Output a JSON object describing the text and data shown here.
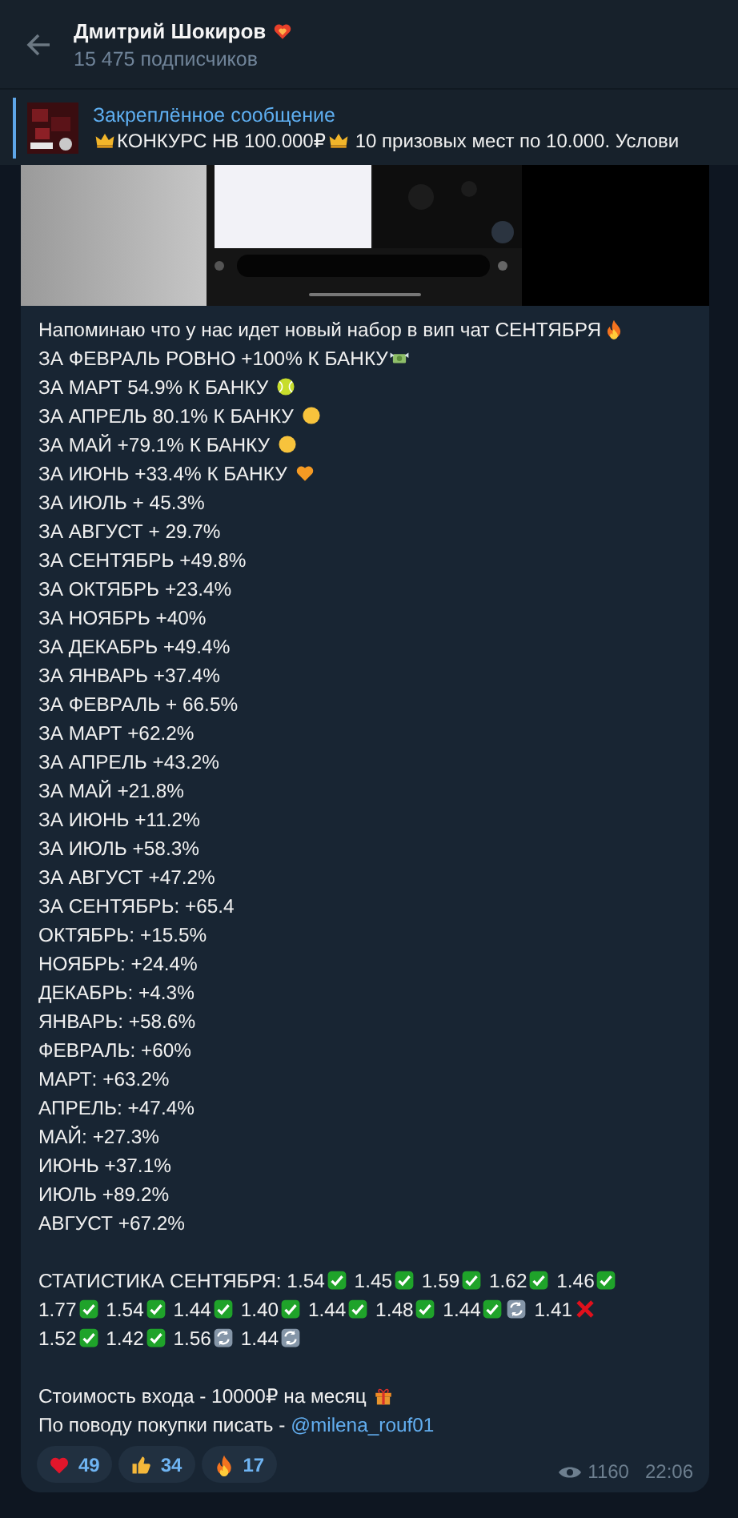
{
  "header": {
    "title": "Дмитрий Шокиров",
    "badge": {
      "kind": "heartfire"
    },
    "subtitle": "15 475 подписчиков"
  },
  "pinned": {
    "label": "Закреплённое сообщение",
    "parts": [
      {
        "kind": "crown"
      },
      {
        "kind": "text",
        "text": "КОНКУРС НВ 100.000₽"
      },
      {
        "kind": "crown"
      },
      {
        "kind": "text",
        "text": " 10 призовых мест по 10.000.  Услови"
      }
    ]
  },
  "message": {
    "lines": [
      {
        "kind": "text",
        "parts": [
          {
            "kind": "text",
            "text": "Напоминаю что у нас идет новый набор в вип чат СЕНТЯБРЯ"
          },
          {
            "kind": "fire"
          }
        ]
      },
      {
        "kind": "text",
        "parts": [
          {
            "kind": "text",
            "text": "ЗА ФЕВРАЛЬ РОВНО +100% К БАНКУ"
          },
          {
            "kind": "money"
          }
        ]
      },
      {
        "kind": "text",
        "parts": [
          {
            "kind": "text",
            "text": "ЗА МАРТ 54.9% К БАНКУ "
          },
          {
            "kind": "ball"
          }
        ]
      },
      {
        "kind": "text",
        "parts": [
          {
            "kind": "text",
            "text": "ЗА АПРЕЛЬ 80.1% К БАНКУ "
          },
          {
            "kind": "face"
          }
        ]
      },
      {
        "kind": "text",
        "parts": [
          {
            "kind": "text",
            "text": "ЗА МАЙ +79.1% К БАНКУ "
          },
          {
            "kind": "face"
          }
        ]
      },
      {
        "kind": "text",
        "parts": [
          {
            "kind": "text",
            "text": "ЗА ИЮНЬ +33.4% К БАНКУ "
          },
          {
            "kind": "orangeheart"
          }
        ]
      },
      {
        "kind": "text",
        "parts": [
          {
            "kind": "text",
            "text": "ЗА ИЮЛЬ + 45.3%"
          }
        ]
      },
      {
        "kind": "text",
        "parts": [
          {
            "kind": "text",
            "text": "ЗА АВГУСТ + 29.7%"
          }
        ]
      },
      {
        "kind": "text",
        "parts": [
          {
            "kind": "text",
            "text": "ЗА СЕНТЯБРЬ +49.8%"
          }
        ]
      },
      {
        "kind": "text",
        "parts": [
          {
            "kind": "text",
            "text": "ЗА ОКТЯБРЬ +23.4%"
          }
        ]
      },
      {
        "kind": "text",
        "parts": [
          {
            "kind": "text",
            "text": "ЗА НОЯБРЬ +40%"
          }
        ]
      },
      {
        "kind": "text",
        "parts": [
          {
            "kind": "text",
            "text": "ЗА ДЕКАБРЬ +49.4%"
          }
        ]
      },
      {
        "kind": "text",
        "parts": [
          {
            "kind": "text",
            "text": "ЗА ЯНВАРЬ +37.4%"
          }
        ]
      },
      {
        "kind": "text",
        "parts": [
          {
            "kind": "text",
            "text": "ЗА ФЕВРАЛЬ + 66.5%"
          }
        ]
      },
      {
        "kind": "text",
        "parts": [
          {
            "kind": "text",
            "text": "ЗА МАРТ +62.2%"
          }
        ]
      },
      {
        "kind": "text",
        "parts": [
          {
            "kind": "text",
            "text": "ЗА АПРЕЛЬ +43.2%"
          }
        ]
      },
      {
        "kind": "text",
        "parts": [
          {
            "kind": "text",
            "text": "ЗА МАЙ +21.8%"
          }
        ]
      },
      {
        "kind": "text",
        "parts": [
          {
            "kind": "text",
            "text": "ЗА ИЮНЬ +11.2%"
          }
        ]
      },
      {
        "kind": "text",
        "parts": [
          {
            "kind": "text",
            "text": "ЗА ИЮЛЬ +58.3%"
          }
        ]
      },
      {
        "kind": "text",
        "parts": [
          {
            "kind": "text",
            "text": "ЗА АВГУСТ +47.2%"
          }
        ]
      },
      {
        "kind": "text",
        "parts": [
          {
            "kind": "text",
            "text": "ЗА СЕНТЯБРЬ: +65.4"
          }
        ]
      },
      {
        "kind": "text",
        "parts": [
          {
            "kind": "text",
            "text": "ОКТЯБРЬ: +15.5%"
          }
        ]
      },
      {
        "kind": "text",
        "parts": [
          {
            "kind": "text",
            "text": "НОЯБРЬ: +24.4%"
          }
        ]
      },
      {
        "kind": "text",
        "parts": [
          {
            "kind": "text",
            "text": "ДЕКАБРЬ: +4.3%"
          }
        ]
      },
      {
        "kind": "text",
        "parts": [
          {
            "kind": "text",
            "text": "ЯНВАРЬ: +58.6%"
          }
        ]
      },
      {
        "kind": "text",
        "parts": [
          {
            "kind": "text",
            "text": "ФЕВРАЛЬ: +60%"
          }
        ]
      },
      {
        "kind": "text",
        "parts": [
          {
            "kind": "text",
            "text": "МАРТ: +63.2%"
          }
        ]
      },
      {
        "kind": "text",
        "parts": [
          {
            "kind": "text",
            "text": "АПРЕЛЬ: +47.4%"
          }
        ]
      },
      {
        "kind": "text",
        "parts": [
          {
            "kind": "text",
            "text": "МАЙ: +27.3%"
          }
        ]
      },
      {
        "kind": "text",
        "parts": [
          {
            "kind": "text",
            "text": "ИЮНЬ +37.1%"
          }
        ]
      },
      {
        "kind": "text",
        "parts": [
          {
            "kind": "text",
            "text": "ИЮЛЬ +89.2%"
          }
        ]
      },
      {
        "kind": "text",
        "parts": [
          {
            "kind": "text",
            "text": "АВГУСТ +67.2%"
          }
        ]
      },
      {
        "kind": "blank"
      },
      {
        "kind": "text",
        "parts": [
          {
            "kind": "text",
            "text": "СТАТИСТИКА СЕНТЯБРЯ: 1.54"
          },
          {
            "kind": "check"
          },
          {
            "kind": "text",
            "text": " 1.45"
          },
          {
            "kind": "check"
          },
          {
            "kind": "text",
            "text": " 1.59"
          },
          {
            "kind": "check"
          },
          {
            "kind": "text",
            "text": " 1.62"
          },
          {
            "kind": "check"
          },
          {
            "kind": "text",
            "text": " 1.46"
          },
          {
            "kind": "check"
          },
          {
            "kind": "break"
          },
          {
            "kind": "text",
            "text": "1.77"
          },
          {
            "kind": "check"
          },
          {
            "kind": "text",
            "text": " 1.54"
          },
          {
            "kind": "check"
          },
          {
            "kind": "text",
            "text": " 1.44"
          },
          {
            "kind": "check"
          },
          {
            "kind": "text",
            "text": " 1.40"
          },
          {
            "kind": "check"
          },
          {
            "kind": "text",
            "text": " 1.44"
          },
          {
            "kind": "check"
          },
          {
            "kind": "text",
            "text": " 1.48"
          },
          {
            "kind": "check"
          },
          {
            "kind": "text",
            "text": " 1.44"
          },
          {
            "kind": "check"
          },
          {
            "kind": "refresh"
          },
          {
            "kind": "text",
            "text": " 1.41"
          },
          {
            "kind": "cross"
          },
          {
            "kind": "break"
          },
          {
            "kind": "text",
            "text": "1.52"
          },
          {
            "kind": "check"
          },
          {
            "kind": "text",
            "text": " 1.42"
          },
          {
            "kind": "check"
          },
          {
            "kind": "text",
            "text": " 1.56"
          },
          {
            "kind": "refresh"
          },
          {
            "kind": "text",
            "text": " 1.44"
          },
          {
            "kind": "refresh"
          }
        ]
      },
      {
        "kind": "blank"
      },
      {
        "kind": "text",
        "parts": [
          {
            "kind": "text",
            "text": "Стоимость входа - 10000₽ на месяц "
          },
          {
            "kind": "gift"
          }
        ]
      },
      {
        "kind": "text",
        "parts": [
          {
            "kind": "text",
            "text": "По поводу покупки писать - "
          },
          {
            "kind": "link",
            "text": "@milena_rouf01"
          }
        ]
      }
    ],
    "reactions": [
      {
        "kind": "heart",
        "count": "49"
      },
      {
        "kind": "thumbsup",
        "count": "34"
      },
      {
        "kind": "fire",
        "count": "17"
      }
    ],
    "views": "1160",
    "time": "22:06"
  }
}
